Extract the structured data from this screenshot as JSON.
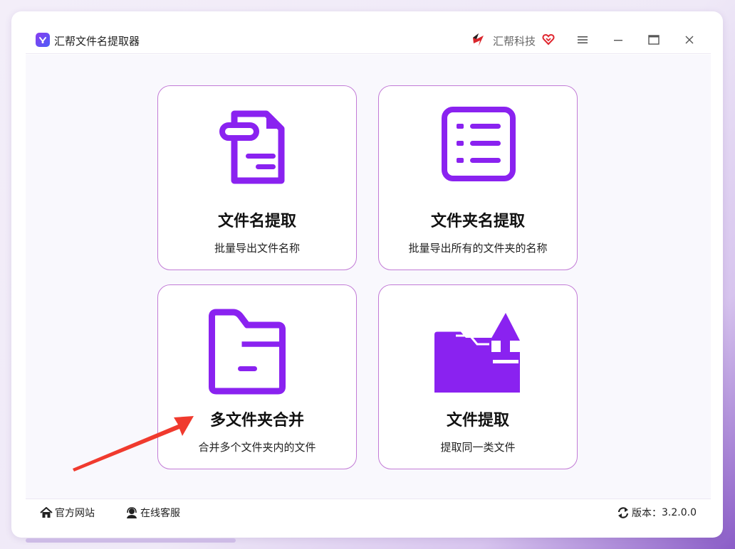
{
  "app": {
    "title": "汇帮文件名提取器"
  },
  "brand": {
    "name": "汇帮科技"
  },
  "colors": {
    "accent": "#8a22f0",
    "card_border": "#c27bd6",
    "arrow": "#f03a2e"
  },
  "cards": [
    {
      "title": "文件名提取",
      "desc": "批量导出文件名称",
      "icon": "document-icon"
    },
    {
      "title": "文件夹名提取",
      "desc": "批量导出所有的文件夹的名称",
      "icon": "list-icon"
    },
    {
      "title": "多文件夹合并",
      "desc": "合并多个文件夹内的文件",
      "icon": "folder-icon"
    },
    {
      "title": "文件提取",
      "desc": "提取同一类文件",
      "icon": "folder-export-icon"
    }
  ],
  "footer": {
    "website": "官方网站",
    "service": "在线客服",
    "version_label": "版本：",
    "version_value": "3.2.0.0"
  }
}
